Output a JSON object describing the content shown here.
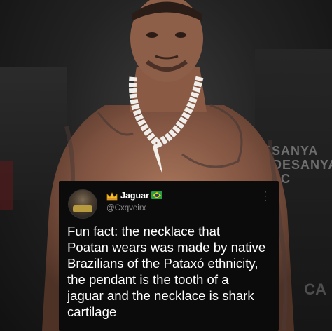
{
  "background": {
    "banner_text": "ESANYA\nADESANYA\nUFC",
    "banner_text_bottom": "CA"
  },
  "tweet": {
    "display_name": "Jaguar",
    "handle": "@Cxqveirx",
    "crown_icon": "crown-emoji",
    "flag_icon": "brazil-flag-emoji",
    "more_icon": "vertical-ellipsis-icon",
    "lines": [
      "Fun fact: the necklace that",
      "Poatan wears was made by native",
      "Brazilians of the Pataxó ethnicity,",
      "the pendant is the tooth of a",
      "jaguar and the necklace is shark",
      "cartilage"
    ]
  },
  "colors": {
    "card_bg": "#0b0b0b",
    "text": "#ffffff",
    "muted": "#8b8b8b"
  }
}
